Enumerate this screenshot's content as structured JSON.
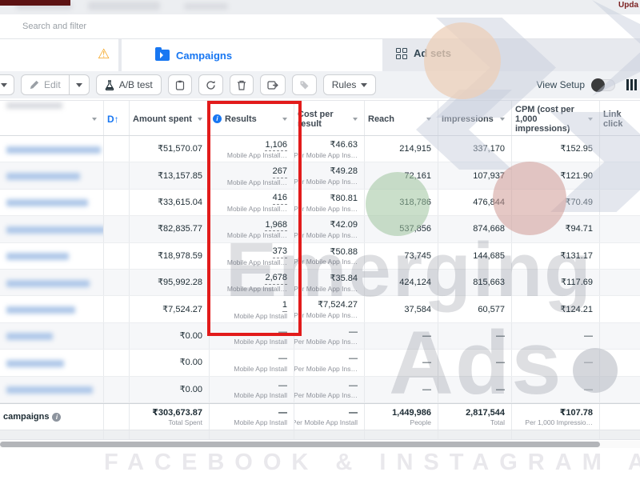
{
  "meta": {
    "updated_text": "Upda"
  },
  "search": {
    "placeholder": "Search and filter"
  },
  "tabs": {
    "campaigns_label": "Campaigns",
    "adsets_label": "Ad sets"
  },
  "toolbar": {
    "edit_label": "Edit",
    "ab_test_label": "A/B test",
    "rules_label": "Rules",
    "view_setup_label": "View Setup"
  },
  "table": {
    "headers": {
      "sort_letter": "D",
      "sort_arrow": "↑",
      "amount": "Amount spent",
      "results": "Results",
      "cost": "Cost per result",
      "reach": "Reach",
      "impressions": "Impressions",
      "cpm": "CPM (cost per 1,000 impressions)",
      "link_clicks": "Link click"
    },
    "rows": [
      {
        "amount": "₹51,570.07",
        "results": "1,106",
        "results_label": "Mobile App Install…",
        "cost": "₹46.63",
        "cost_label": "Per Mobile App Ins…",
        "reach": "214,915",
        "impressions": "337,170",
        "cpm": "₹152.95"
      },
      {
        "amount": "₹13,157.85",
        "results": "267",
        "results_label": "Mobile App Install…",
        "cost": "₹49.28",
        "cost_label": "Per Mobile App Ins…",
        "reach": "72,161",
        "impressions": "107,937",
        "cpm": "₹121.90"
      },
      {
        "amount": "₹33,615.04",
        "results": "416",
        "results_label": "Mobile App Install…",
        "cost": "₹80.81",
        "cost_label": "Per Mobile App Ins…",
        "reach": "318,786",
        "impressions": "476,844",
        "cpm": "₹70.49"
      },
      {
        "amount": "₹82,835.77",
        "results": "1,968",
        "results_label": "Mobile App Install…",
        "cost": "₹42.09",
        "cost_label": "Per Mobile App Ins…",
        "reach": "537,856",
        "impressions": "874,668",
        "cpm": "₹94.71"
      },
      {
        "amount": "₹18,978.59",
        "results": "373",
        "results_label": "Mobile App Install…",
        "cost": "₹50.88",
        "cost_label": "Per Mobile App Ins…",
        "reach": "73,745",
        "impressions": "144,685",
        "cpm": "₹131.17"
      },
      {
        "amount": "₹95,992.28",
        "results": "2,678",
        "results_label": "Mobile App Install…",
        "cost": "₹35.84",
        "cost_label": "Per Mobile App Ins…",
        "reach": "424,124",
        "impressions": "815,663",
        "cpm": "₹117.69"
      },
      {
        "amount": "₹7,524.27",
        "results": "1",
        "results_label": "Mobile App Install",
        "cost": "₹7,524.27",
        "cost_label": "Per Mobile App Ins…",
        "reach": "37,584",
        "impressions": "60,577",
        "cpm": "₹124.21"
      },
      {
        "amount": "₹0.00",
        "results": "—",
        "results_label": "Mobile App Install",
        "cost": "—",
        "cost_label": "Per Mobile App Ins…",
        "reach": "—",
        "impressions": "—",
        "cpm": "—"
      },
      {
        "amount": "₹0.00",
        "results": "—",
        "results_label": "Mobile App Install",
        "cost": "—",
        "cost_label": "Per Mobile App Ins…",
        "reach": "—",
        "impressions": "—",
        "cpm": "—"
      },
      {
        "amount": "₹0.00",
        "results": "—",
        "results_label": "Mobile App Install",
        "cost": "—",
        "cost_label": "Per Mobile App Ins…",
        "reach": "—",
        "impressions": "—",
        "cpm": "—"
      }
    ],
    "totals": {
      "label": "campaigns",
      "amount": "₹303,673.87",
      "amount_label": "Total Spent",
      "results": "—",
      "results_label": "Mobile App Install",
      "cost": "—",
      "cost_label": "Per Mobile App Install",
      "reach": "1,449,986",
      "reach_label": "People",
      "impressions": "2,817,544",
      "impressions_label": "Total",
      "cpm": "₹107.78",
      "cpm_label": "Per 1,000 Impressio…"
    }
  },
  "watermark": {
    "word1": "Emerging",
    "word2": "Ads",
    "banner": "FACEBOOK & INSTAGRAM ADVE"
  },
  "colors": {
    "accent": "#1877f2",
    "highlight": "#e21b1b",
    "warning": "#f5a623",
    "maroon": "#5c1212"
  }
}
